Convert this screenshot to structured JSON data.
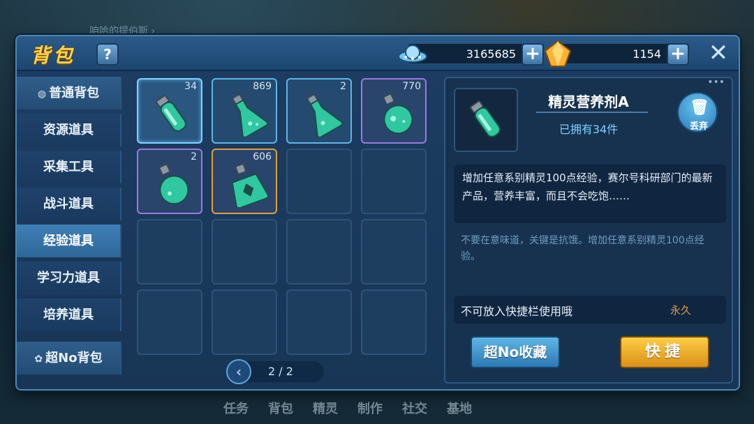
{
  "background": {
    "top_hint": "咱哈的提伯斯 ›",
    "bottom_nav": [
      "任务",
      "背包",
      "精灵",
      "制作",
      "社交",
      "基地"
    ]
  },
  "header": {
    "title": "背包",
    "help_label": "?",
    "currency_1": "3165685",
    "currency_2": "1154",
    "plus_label": "+",
    "close_label": "✕"
  },
  "sidebar": {
    "items": [
      {
        "label": "普通背包",
        "icon": "bag-icon"
      },
      {
        "label": "资源道具"
      },
      {
        "label": "采集工具"
      },
      {
        "label": "战斗道具"
      },
      {
        "label": "经验道具"
      },
      {
        "label": "学习力道具"
      },
      {
        "label": "培养道具"
      }
    ],
    "bottom": {
      "label": "超No背包",
      "icon": "cat-icon"
    }
  },
  "grid": {
    "cells": [
      {
        "count": "34",
        "frame": "blue",
        "item": "potion-vial"
      },
      {
        "count": "869",
        "frame": "blue",
        "item": "potion-flask"
      },
      {
        "count": "2",
        "frame": "blue",
        "item": "potion-flask"
      },
      {
        "count": "770",
        "frame": "purple",
        "item": "potion-round"
      },
      {
        "count": "2",
        "frame": "purple",
        "item": "potion-round"
      },
      {
        "count": "606",
        "frame": "orange",
        "item": "potion-gold"
      }
    ],
    "page": "2 / 2"
  },
  "detail": {
    "name": "精灵营养剂A",
    "owned": "已拥有34件",
    "discard_label": "丢弃",
    "description": "增加任意系别精灵100点经验，赛尔号科研部门的最新产品，营养丰富，而且不会吃饱……",
    "flavor": "不要在意味道，关键是抗饿。增加任意系别精灵100点经验。",
    "limit_text": "不可放入快捷栏使用哦",
    "duration": "永久",
    "collect_label": "超No收藏",
    "quick_label": "快捷"
  },
  "colors": {
    "title": "#ffd24a",
    "accent_blue": "#5fb6e6",
    "accent_gold": "#e0a040"
  }
}
